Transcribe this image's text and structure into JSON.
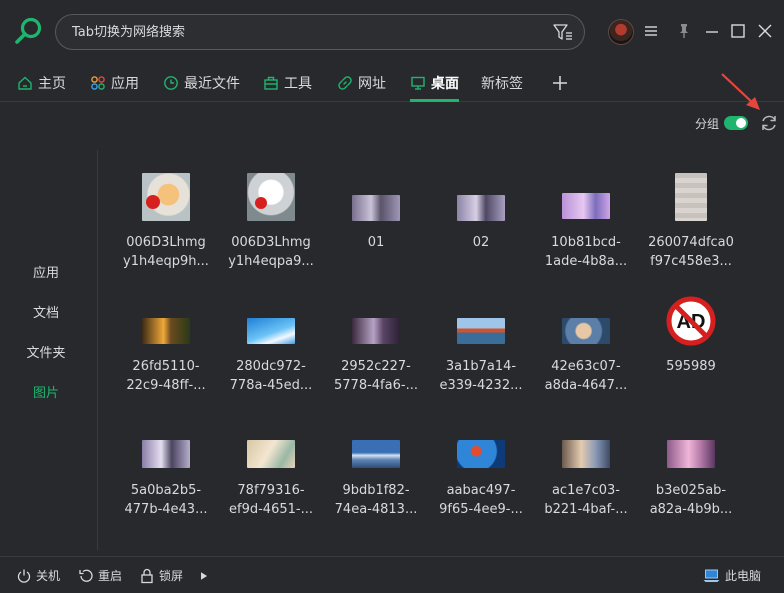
{
  "search": {
    "placeholder": "Tab切换为网络搜索"
  },
  "tabs": [
    {
      "label": "主页",
      "icon": "home-icon"
    },
    {
      "label": "应用",
      "icon": "apps-icon"
    },
    {
      "label": "最近文件",
      "icon": "clock-icon"
    },
    {
      "label": "工具",
      "icon": "toolbox-icon"
    },
    {
      "label": "网址",
      "icon": "link-icon"
    },
    {
      "label": "桌面",
      "icon": "monitor-icon",
      "active": true
    },
    {
      "label": "新标签"
    }
  ],
  "group": {
    "label": "分组",
    "enabled": true
  },
  "sidebar": {
    "items": [
      {
        "label": "应用"
      },
      {
        "label": "文档"
      },
      {
        "label": "文件夹"
      },
      {
        "label": "图片",
        "active": true
      }
    ]
  },
  "grid": {
    "items": [
      {
        "line1": "006D3Lhmg",
        "line2": "y1h4eqp9h..."
      },
      {
        "line1": "006D3Lhmg",
        "line2": "y1h4eqpa9..."
      },
      {
        "line1": "01",
        "line2": ""
      },
      {
        "line1": "02",
        "line2": ""
      },
      {
        "line1": "10b81bcd-",
        "line2": "1ade-4b8a..."
      },
      {
        "line1": "260074dfca0",
        "line2": "f97c458e3..."
      },
      {
        "line1": "26fd5110-",
        "line2": "22c9-48ff-..."
      },
      {
        "line1": "280dc972-",
        "line2": "778a-45ed..."
      },
      {
        "line1": "2952c227-",
        "line2": "5778-4fa6-..."
      },
      {
        "line1": "3a1b7a14-",
        "line2": "e339-4232..."
      },
      {
        "line1": "42e63c07-",
        "line2": "a8da-4647..."
      },
      {
        "line1": "595989",
        "line2": "",
        "badge": "AD"
      },
      {
        "line1": "5a0ba2b5-",
        "line2": "477b-4e43..."
      },
      {
        "line1": "78f79316-",
        "line2": "ef9d-4651-..."
      },
      {
        "line1": "9bdb1f82-",
        "line2": "74ea-4813..."
      },
      {
        "line1": "aabac497-",
        "line2": "9f65-4ee9-..."
      },
      {
        "line1": "ac1e7c03-",
        "line2": "b221-4baf-..."
      },
      {
        "line1": "b3e025ab-",
        "line2": "a82a-4b9b..."
      }
    ]
  },
  "bottom": {
    "shutdown": "关机",
    "restart": "重启",
    "lock": "锁屏",
    "computer": "此电脑"
  },
  "colors": {
    "accent": "#1fb56f",
    "background": "#28292d",
    "arrow": "#e8463c"
  }
}
